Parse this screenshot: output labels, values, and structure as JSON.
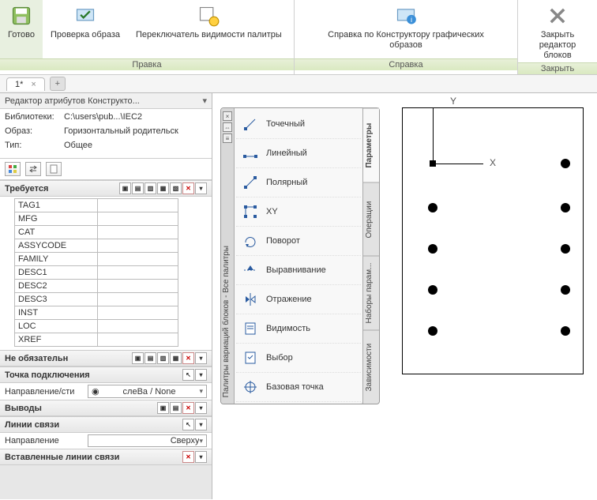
{
  "ribbon": {
    "panels": [
      {
        "title": "Правка",
        "buttons": [
          {
            "id": "done",
            "label": "Готово"
          },
          {
            "id": "check",
            "label": "Проверка образа"
          },
          {
            "id": "toggle-palette",
            "label": "Переключатель видимости палитры"
          }
        ]
      },
      {
        "title": "Справка",
        "buttons": [
          {
            "id": "help",
            "label": "Справка по Конструктору графических образов"
          }
        ]
      },
      {
        "title": "Закрыть",
        "buttons": [
          {
            "id": "close-editor",
            "label": "Закрыть\nредактор блоков"
          }
        ]
      }
    ]
  },
  "doc_tab": {
    "name": "1*",
    "close": "×",
    "plus": "+"
  },
  "attr_editor": {
    "title": "Редактор атрибутов Конструкто...",
    "info": {
      "lib_key": "Библиотеки:",
      "lib_val": "C:\\users\\pub...\\IEC2",
      "shape_key": "Образ:",
      "shape_val": "Горизонтальный родительск",
      "type_key": "Тип:",
      "type_val": "Общее"
    },
    "sections": {
      "required": {
        "title": "Требуется",
        "rows": [
          "TAG1",
          "MFG",
          "CAT",
          "ASSYCODE",
          "FAMILY",
          "DESC1",
          "DESC2",
          "DESC3",
          "INST",
          "LOC",
          "XREF"
        ]
      },
      "optional": {
        "title": "Не обязательн"
      },
      "connection": {
        "title": "Точка подключения",
        "dir_label": "Направление/сти",
        "dir_val": "слеВа / None"
      },
      "outputs": {
        "title": "Выводы"
      },
      "wires": {
        "title": "Линии связи",
        "dir_label": "Направление",
        "dir_val": "Сверху"
      },
      "inserted_wires": {
        "title": "Вставленные линии связи"
      }
    }
  },
  "palette": {
    "grip_title": "Палитры вариаций блоков - Все палитры",
    "side_tabs": [
      "Параметры",
      "Операции",
      "Наборы парам...",
      "Зависимости"
    ],
    "items": [
      {
        "id": "point",
        "label": "Точечный"
      },
      {
        "id": "linear",
        "label": "Линейный"
      },
      {
        "id": "polar",
        "label": "Полярный"
      },
      {
        "id": "xy",
        "label": "XY"
      },
      {
        "id": "rotate",
        "label": "Поворот"
      },
      {
        "id": "align",
        "label": "Выравнивание"
      },
      {
        "id": "mirror",
        "label": "Отражение"
      },
      {
        "id": "visibility",
        "label": "Видимость"
      },
      {
        "id": "select",
        "label": "Выбор"
      },
      {
        "id": "basepoint",
        "label": "Базовая точка"
      }
    ]
  },
  "axis": {
    "x": "X",
    "y": "Y"
  }
}
